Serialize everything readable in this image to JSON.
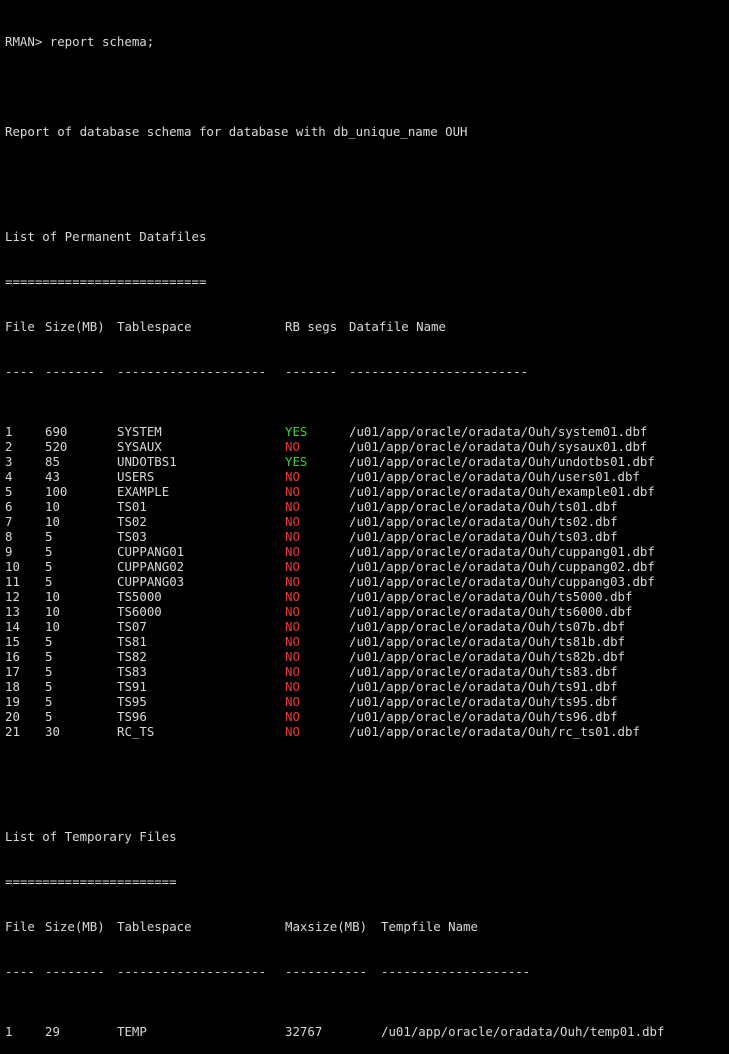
{
  "prompt": "RMAN> report schema;",
  "report_header": "Report of database schema for database with db_unique_name OUH",
  "permanent": {
    "title": "List of Permanent Datafiles",
    "underline": "===========================",
    "headers": {
      "file": "File",
      "size": "Size(MB)",
      "tablespace": "Tablespace",
      "rb": "RB segs",
      "name": "Datafile Name"
    },
    "dashes": {
      "file": "----",
      "size": "--------",
      "tablespace": "--------------------",
      "rb": "-------",
      "name": "------------------------"
    },
    "rows": [
      {
        "file": "1",
        "size": "690",
        "tablespace": "SYSTEM",
        "rb": "YES",
        "name": "/u01/app/oracle/oradata/Ouh/system01.dbf"
      },
      {
        "file": "2",
        "size": "520",
        "tablespace": "SYSAUX",
        "rb": "NO",
        "name": "/u01/app/oracle/oradata/Ouh/sysaux01.dbf"
      },
      {
        "file": "3",
        "size": "85",
        "tablespace": "UNDOTBS1",
        "rb": "YES",
        "name": "/u01/app/oracle/oradata/Ouh/undotbs01.dbf"
      },
      {
        "file": "4",
        "size": "43",
        "tablespace": "USERS",
        "rb": "NO",
        "name": "/u01/app/oracle/oradata/Ouh/users01.dbf"
      },
      {
        "file": "5",
        "size": "100",
        "tablespace": "EXAMPLE",
        "rb": "NO",
        "name": "/u01/app/oracle/oradata/Ouh/example01.dbf"
      },
      {
        "file": "6",
        "size": "10",
        "tablespace": "TS01",
        "rb": "NO",
        "name": "/u01/app/oracle/oradata/Ouh/ts01.dbf"
      },
      {
        "file": "7",
        "size": "10",
        "tablespace": "TS02",
        "rb": "NO",
        "name": "/u01/app/oracle/oradata/Ouh/ts02.dbf"
      },
      {
        "file": "8",
        "size": "5",
        "tablespace": "TS03",
        "rb": "NO",
        "name": "/u01/app/oracle/oradata/Ouh/ts03.dbf"
      },
      {
        "file": "9",
        "size": "5",
        "tablespace": "CUPPANG01",
        "rb": "NO",
        "name": "/u01/app/oracle/oradata/Ouh/cuppang01.dbf"
      },
      {
        "file": "10",
        "size": "5",
        "tablespace": "CUPPANG02",
        "rb": "NO",
        "name": "/u01/app/oracle/oradata/Ouh/cuppang02.dbf"
      },
      {
        "file": "11",
        "size": "5",
        "tablespace": "CUPPANG03",
        "rb": "NO",
        "name": "/u01/app/oracle/oradata/Ouh/cuppang03.dbf"
      },
      {
        "file": "12",
        "size": "10",
        "tablespace": "TS5000",
        "rb": "NO",
        "name": "/u01/app/oracle/oradata/Ouh/ts5000.dbf"
      },
      {
        "file": "13",
        "size": "10",
        "tablespace": "TS6000",
        "rb": "NO",
        "name": "/u01/app/oracle/oradata/Ouh/ts6000.dbf"
      },
      {
        "file": "14",
        "size": "10",
        "tablespace": "TS07",
        "rb": "NO",
        "name": "/u01/app/oracle/oradata/Ouh/ts07b.dbf"
      },
      {
        "file": "15",
        "size": "5",
        "tablespace": "TS81",
        "rb": "NO",
        "name": "/u01/app/oracle/oradata/Ouh/ts81b.dbf"
      },
      {
        "file": "16",
        "size": "5",
        "tablespace": "TS82",
        "rb": "NO",
        "name": "/u01/app/oracle/oradata/Ouh/ts82b.dbf"
      },
      {
        "file": "17",
        "size": "5",
        "tablespace": "TS83",
        "rb": "NO",
        "name": "/u01/app/oracle/oradata/Ouh/ts83.dbf"
      },
      {
        "file": "18",
        "size": "5",
        "tablespace": "TS91",
        "rb": "NO",
        "name": "/u01/app/oracle/oradata/Ouh/ts91.dbf"
      },
      {
        "file": "19",
        "size": "5",
        "tablespace": "TS95",
        "rb": "NO",
        "name": "/u01/app/oracle/oradata/Ouh/ts95.dbf"
      },
      {
        "file": "20",
        "size": "5",
        "tablespace": "TS96",
        "rb": "NO",
        "name": "/u01/app/oracle/oradata/Ouh/ts96.dbf"
      },
      {
        "file": "21",
        "size": "30",
        "tablespace": "RC_TS",
        "rb": "NO",
        "name": "/u01/app/oracle/oradata/Ouh/rc_ts01.dbf"
      }
    ]
  },
  "temporary": {
    "title": "List of Temporary Files",
    "underline": "=======================",
    "headers": {
      "file": "File",
      "size": "Size(MB)",
      "tablespace": "Tablespace",
      "max": "Maxsize(MB)",
      "name": "Tempfile Name"
    },
    "dashes": {
      "file": "----",
      "size": "--------",
      "tablespace": "--------------------",
      "max": "-----------",
      "name": "--------------------"
    },
    "rows": [
      {
        "file": "1",
        "size": "29",
        "tablespace": "TEMP",
        "max": "32767",
        "name": "/u01/app/oracle/oradata/Ouh/temp01.dbf"
      }
    ]
  },
  "colors": {
    "background": "#000000",
    "text": "#d9d9d9",
    "yes": "#3ecf3e",
    "no": "#e53a3a"
  }
}
